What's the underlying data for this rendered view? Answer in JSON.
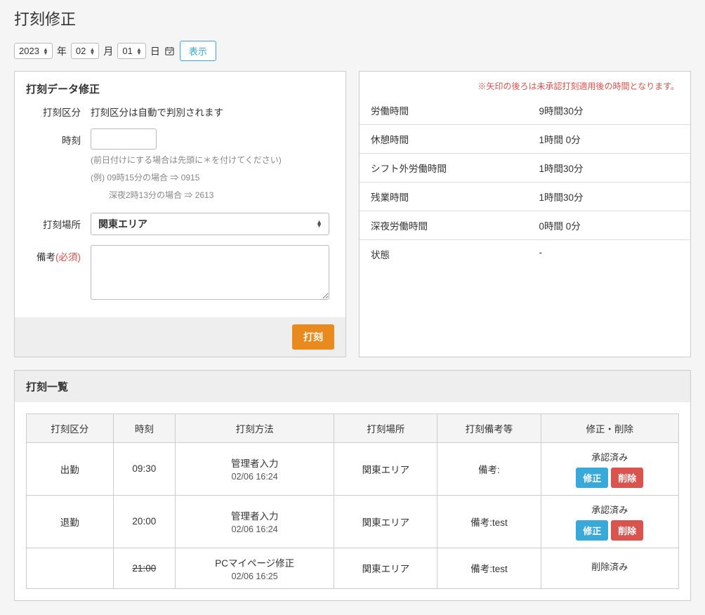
{
  "page": {
    "title": "打刻修正"
  },
  "dateBar": {
    "yearValue": "2023",
    "yearLabel": "年",
    "monthValue": "02",
    "monthLabel": "月",
    "dayValue": "01",
    "dayLabel": "日",
    "showBtn": "表示"
  },
  "form": {
    "title": "打刻データ修正",
    "typeLabel": "打刻区分",
    "typeNote": "打刻区分は自動で判別されます",
    "timeLabel": "時刻",
    "timeHint1": "(前日付けにする場合は先頭に＊を付けてください)",
    "timeHint2": "(例) 09時15分の場合 ⇒ 0915",
    "timeHint3": "深夜2時13分の場合 ⇒ 2613",
    "placeLabel": "打刻場所",
    "placeSelected": "関東エリア",
    "noteLabel": "備考",
    "requiredTag": "(必須)",
    "submitBtn": "打刻"
  },
  "stats": {
    "note": "※矢印の後ろは未承認打刻適用後の時間となります。",
    "rows": [
      {
        "key": "労働時間",
        "val": "9時間30分"
      },
      {
        "key": "休憩時間",
        "val": "1時間 0分"
      },
      {
        "key": "シフト外労働時間",
        "val": "1時間30分"
      },
      {
        "key": "残業時間",
        "val": "1時間30分"
      },
      {
        "key": "深夜労働時間",
        "val": "0時間 0分"
      },
      {
        "key": "状態",
        "val": "-"
      }
    ]
  },
  "list": {
    "title": "打刻一覧",
    "headers": [
      "打刻区分",
      "時刻",
      "打刻方法",
      "打刻場所",
      "打刻備考等",
      "修正・削除"
    ],
    "rows": [
      {
        "type": "出勤",
        "time": "09:30",
        "strike": false,
        "method": "管理者入力",
        "methodTime": "02/06 16:24",
        "place": "関東エリア",
        "note": "備考:",
        "status": "承認済み",
        "editable": true
      },
      {
        "type": "退勤",
        "time": "20:00",
        "strike": false,
        "method": "管理者入力",
        "methodTime": "02/06 16:24",
        "place": "関東エリア",
        "note": "備考:test",
        "status": "承認済み",
        "editable": true
      },
      {
        "type": "",
        "time": "21:00",
        "strike": true,
        "method": "PCマイページ修正",
        "methodTime": "02/06 16:25",
        "place": "関東エリア",
        "note": "備考:test",
        "status": "削除済み",
        "editable": false
      }
    ],
    "editBtn": "修正",
    "delBtn": "削除"
  }
}
